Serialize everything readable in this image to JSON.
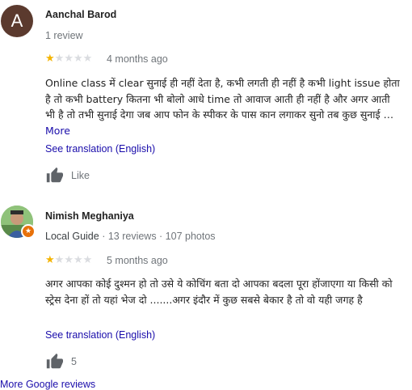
{
  "reviews": [
    {
      "avatar_letter": "A",
      "name": "Aanchal Barod",
      "meta": "1 review",
      "rating": 1,
      "date": "4 months ago",
      "text": "Online class में clear सुनाई ही नहीं देता है, कभी लगती ही नहीं है कभी light issue होता है तो कभी battery कितना भी बोलो आधे time तो आवाज आती ही नहीं है और अगर आती भी है तो तभी सुनाई देगा जब आप फोन के स्पीकर के पास कान लगाकर सुनो तब कुछ सुनाई …",
      "more_label": "More",
      "translate_label": "See translation (English)",
      "like_label": "Like"
    },
    {
      "name": "Nimish Meghaniya",
      "guide_label": "Local Guide",
      "meta": " · 13 reviews · 107 photos",
      "rating": 1,
      "date": "5 months ago",
      "text": "अगर आपका कोई दुश्मन हो तो उसे ये कोचिंग बता दो आपका बदला पूरा होंजाएगा या किसी को स्ट्रेस देना हों तो यहां भेज दो .......अगर इंदौर में कुछ सबसे बेकार है तो वो यही जगह है",
      "translate_label": "See translation (English)",
      "like_count": "5"
    }
  ],
  "footer": {
    "more_reviews_label": "More Google reviews"
  },
  "colors": {
    "link": "#1a0dab",
    "star": "#f4b400",
    "meta": "#70757a"
  },
  "icons": [
    "thumbs-up-icon",
    "star-icon",
    "local-guide-badge-icon"
  ]
}
